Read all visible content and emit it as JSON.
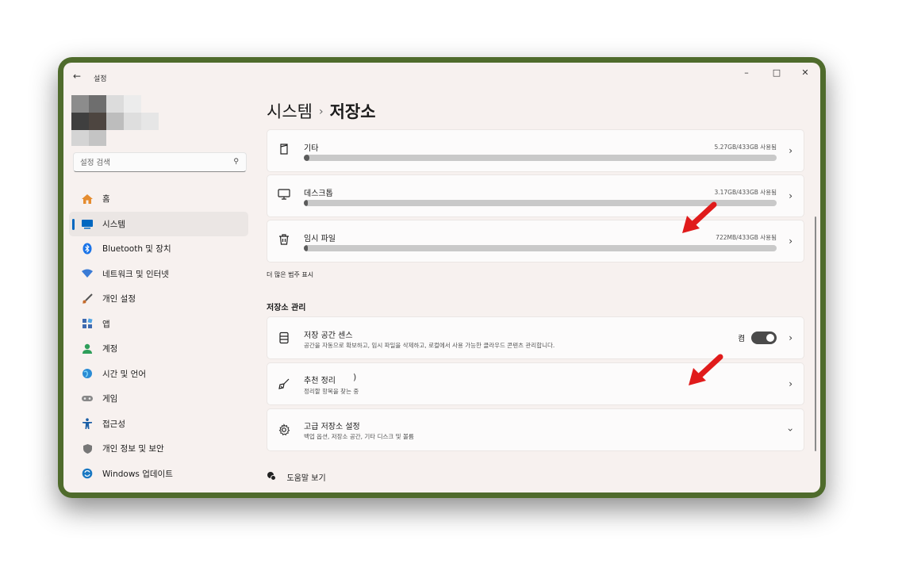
{
  "window": {
    "title": "설정",
    "back_icon": "back-arrow-icon",
    "controls": [
      "minimize-icon",
      "maximize-icon",
      "close-icon"
    ]
  },
  "sidebar": {
    "search_placeholder": "설정 검색",
    "items": [
      {
        "label": "홈",
        "icon": "home-icon",
        "color": "#e58c2f"
      },
      {
        "label": "시스템",
        "icon": "system-icon",
        "color": "#0067c0",
        "active": true
      },
      {
        "label": "Bluetooth 및 장치",
        "icon": "bluetooth-icon",
        "color": "#1a73e8"
      },
      {
        "label": "네트워크 및 인터넷",
        "icon": "wifi-icon",
        "color": "#3a7bd5"
      },
      {
        "label": "개인 설정",
        "icon": "brush-icon",
        "color": "#c56b2b"
      },
      {
        "label": "앱",
        "icon": "apps-icon",
        "color": "#3d6ab0"
      },
      {
        "label": "계정",
        "icon": "account-icon",
        "color": "#2e9e5a"
      },
      {
        "label": "시간 및 언어",
        "icon": "globe-icon",
        "color": "#2a8bd4"
      },
      {
        "label": "게임",
        "icon": "gamepad-icon",
        "color": "#777777"
      },
      {
        "label": "접근성",
        "icon": "accessibility-icon",
        "color": "#1b5fa6"
      },
      {
        "label": "개인 정보 및 보안",
        "icon": "shield-icon",
        "color": "#666666"
      },
      {
        "label": "Windows 업데이트",
        "icon": "update-icon",
        "color": "#1a78c2"
      }
    ]
  },
  "main": {
    "breadcrumb_parent": "시스템",
    "breadcrumb_separator": "›",
    "breadcrumb_current": "저장소",
    "storage_items": [
      {
        "label": "기타",
        "value": "5.27GB/433GB 사용됨",
        "usage_fraction": 0.012,
        "icon": "file-icon"
      },
      {
        "label": "데스크톱",
        "value": "3.17GB/433GB 사용됨",
        "usage_fraction": 0.008,
        "icon": "monitor-icon"
      },
      {
        "label": "임시 파일",
        "value": "722MB/433GB 사용됨",
        "usage_fraction": 0.002,
        "icon": "trash-icon"
      }
    ],
    "more_categories": "더 많은 범주 표시",
    "management_title": "저장소 관리",
    "storage_sense": {
      "label": "저장 공간 센스",
      "desc": "공간을 자동으로 확보하고, 임시 파일을 삭제하고, 로컬에서 사용 가능한 클라우드 콘텐츠 관리합니다.",
      "toggle_label": "켬",
      "toggle_on": true
    },
    "cleanup": {
      "label": "추천 정리",
      "desc": "정리할 항목을 찾는 중"
    },
    "advanced": {
      "label": "고급 저장소 설정",
      "desc": "백업 옵션, 저장소 공간, 기타 디스크 및 볼륨"
    },
    "help": "도움말 보기",
    "arrow_color": "#e01b1b"
  }
}
